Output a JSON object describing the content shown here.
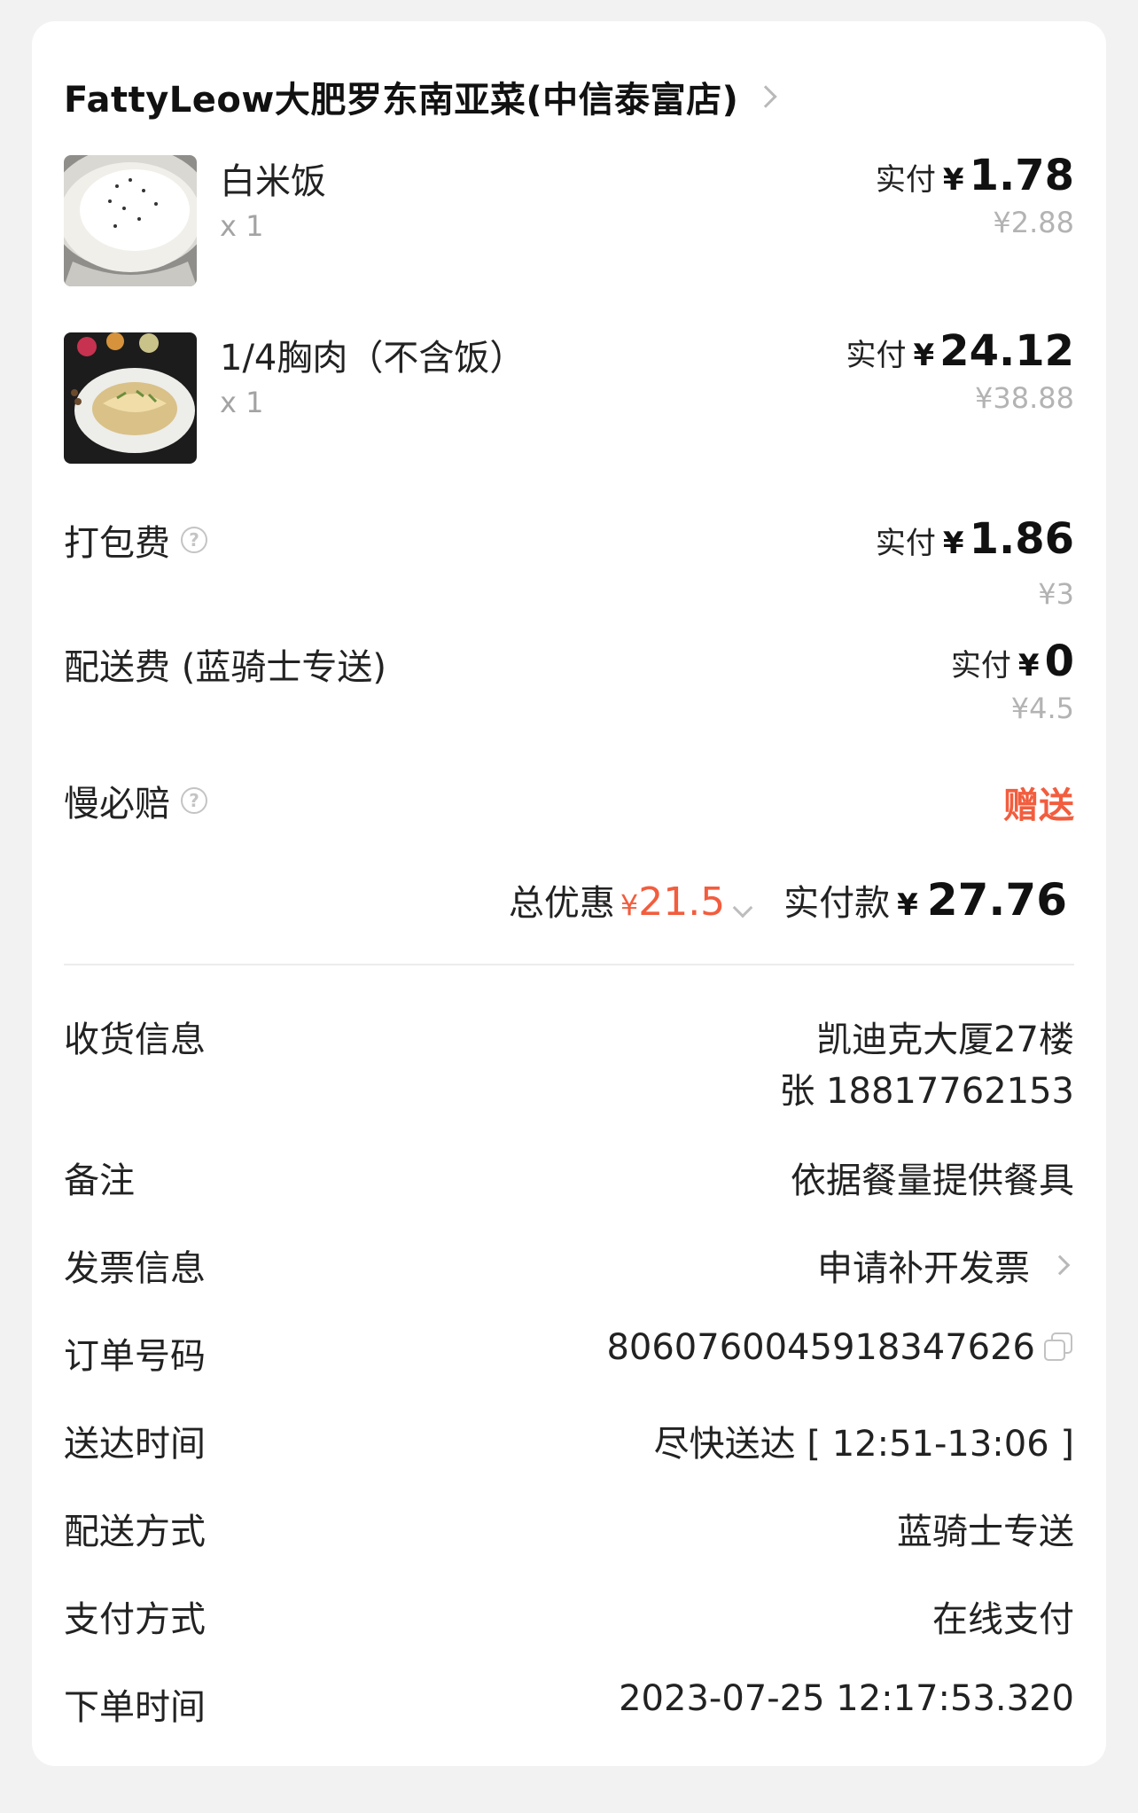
{
  "shop": {
    "name": "FattyLeow大肥罗东南亚菜(中信泰富店)"
  },
  "items": [
    {
      "name": "白米饭",
      "qty": "x 1",
      "paid_label": "实付",
      "currency": "¥",
      "paid": "1.78",
      "original": "¥2.88"
    },
    {
      "name": "1/4胸肉（不含饭）",
      "qty": "x 1",
      "paid_label": "实付",
      "currency": "¥",
      "paid": "24.12",
      "original": "¥38.88"
    }
  ],
  "fees": {
    "packing": {
      "label": "打包费",
      "paid_label": "实付",
      "currency": "¥",
      "paid": "1.86",
      "original": "¥3"
    },
    "delivery": {
      "label": "配送费 (蓝骑士专送)",
      "paid_label": "实付",
      "currency": "¥",
      "paid": "0",
      "original": "¥4.5"
    },
    "late_comp": {
      "label": "慢必赔",
      "value": "赠送"
    }
  },
  "totals": {
    "discount_label": "总优惠",
    "discount_currency": "¥",
    "discount": "21.5",
    "pay_label": "实付款",
    "pay_currency": "¥",
    "pay": "27.76"
  },
  "info": {
    "address": {
      "label": "收货信息",
      "line1": "凯迪克大厦27楼",
      "line2": "张 18817762153"
    },
    "remark": {
      "label": "备注",
      "value": "依据餐量提供餐具"
    },
    "invoice": {
      "label": "发票信息",
      "value": "申请补开发票"
    },
    "order_no": {
      "label": "订单号码",
      "value": "8060760045918347626"
    },
    "delivery_time": {
      "label": "送达时间",
      "value": "尽快送达 [ 12:51-13:06 ]"
    },
    "delivery_method": {
      "label": "配送方式",
      "value": "蓝骑士专送"
    },
    "payment_method": {
      "label": "支付方式",
      "value": "在线支付"
    },
    "order_time": {
      "label": "下单时间",
      "value": "2023-07-25 12:17:53.320"
    }
  },
  "icons": {
    "shop_chevron": "chevron-right-icon",
    "help": "help-circle-icon",
    "copy": "copy-icon"
  },
  "colors": {
    "accent_red": "#f25d3e",
    "muted": "#b3b3b3",
    "background": "#f2f2f2"
  }
}
